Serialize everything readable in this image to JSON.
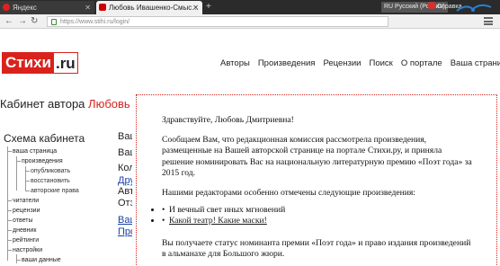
{
  "browser": {
    "tabs": [
      {
        "label": "Яндекс",
        "active": false
      },
      {
        "label": "Любовь Ивашенко-Смыс…",
        "active": true
      }
    ],
    "new_tab": "+",
    "language": "RU Русский (Россия)",
    "help": "Справка",
    "url": "https://www.stihi.ru/login/"
  },
  "site": {
    "logo_main": "Стихи",
    "logo_tld": ".ru",
    "brand_color": "#d9221c",
    "nav": [
      "Авторы",
      "Произведения",
      "Рецензии",
      "Поиск",
      "О портале",
      "Ваша страница"
    ]
  },
  "cabinet": {
    "title": "Кабинет автора",
    "author_name": "Любовь",
    "schema_title": "Схема кабинета",
    "tree": [
      {
        "label": "ваша страница",
        "level": 1
      },
      {
        "label": "произведения",
        "level": 2
      },
      {
        "label": "опубликовать",
        "level": 3
      },
      {
        "label": "восстановить",
        "level": 3
      },
      {
        "label": "авторские права",
        "level": 3
      },
      {
        "label": "читатели",
        "level": 1
      },
      {
        "label": "рецензии",
        "level": 1
      },
      {
        "label": "ответы",
        "level": 1
      },
      {
        "label": "дневник",
        "level": 1
      },
      {
        "label": "рейтинги",
        "level": 1
      },
      {
        "label": "настройки",
        "level": 1
      },
      {
        "label": "ваши данные",
        "level": 2
      }
    ],
    "right_column": [
      "Ваш",
      "Ваш",
      "Кол",
      "Дру",
      "Авт",
      "Отз",
      "Ваш",
      "Про"
    ]
  },
  "message": {
    "greeting": "Здравствуйте, Любовь Дмитриевна!",
    "paragraph1": "Сообщаем Вам, что редакционная комиссия рассмотрела произведения, размещенные на Вашей авторской странице на портале Стихи.ру, и приняла решение номинировать Вас на национальную литературную премию «Поэт года» за 2015 год.",
    "paragraph2": "Нашими редакторами особенно отмечены следующие произведения:",
    "works": [
      "И вечный свет иных мгновений",
      "Какой театр! Какие маски!"
    ],
    "paragraph3": "Вы получаете статус номинанта премии «Поэт года» и право издания произведений в альманахе для Большого жюри."
  }
}
